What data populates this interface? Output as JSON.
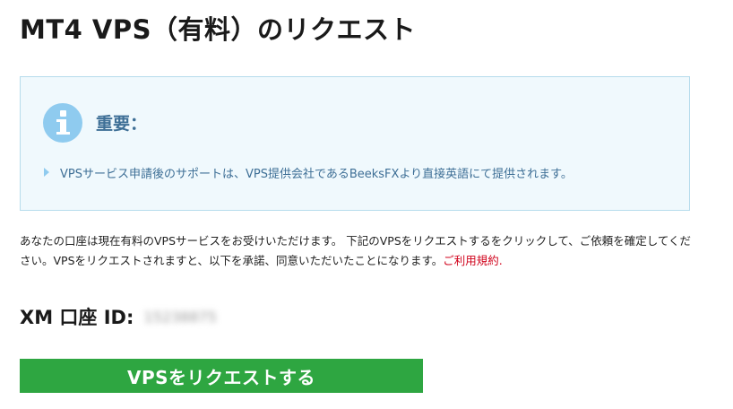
{
  "page": {
    "title": "MT4 VPS（有料）のリクエスト"
  },
  "notice": {
    "icon": "info-icon",
    "heading": "重要：",
    "item": "VPSサービス申請後のサポートは、VPS提供会社であるBeeksFXより直接英語にて提供されます。",
    "accent_color": "#3e6f96",
    "background_color": "#f0f9fd"
  },
  "description": {
    "text": "あなたの口座は現在有料のVPSサービスをお受けいただけます。 下記のVPSをリクエストするをクリックして、ご依頼を確定してください。VPSをリクエストされますと、以下を承諾、同意いただいたことになります。",
    "terms_link": "ご利用規約.",
    "link_color": "#d0021b"
  },
  "account": {
    "label": "XM 口座 ID:",
    "id": "15238875"
  },
  "request_button": {
    "label": "VPSをリクエストする",
    "color": "#2ea641"
  }
}
